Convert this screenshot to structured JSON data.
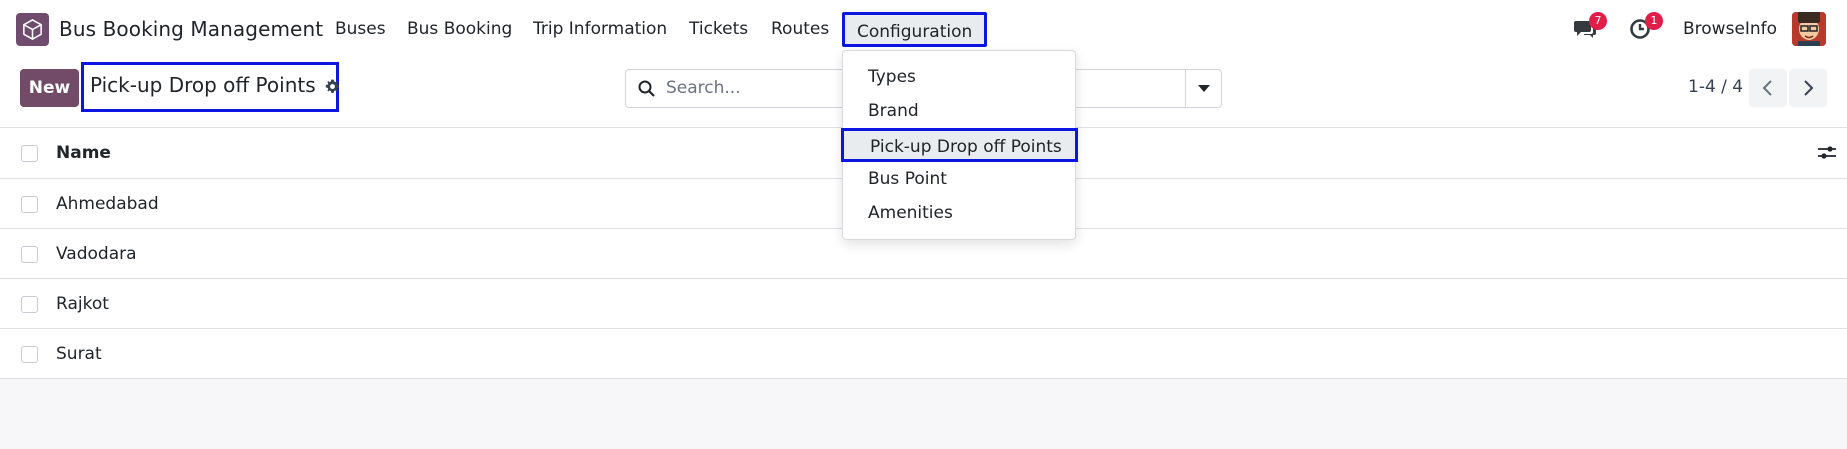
{
  "navbar": {
    "app_title": "Bus Booking Management",
    "menu": [
      {
        "label": "Buses"
      },
      {
        "label": "Bus Booking"
      },
      {
        "label": "Trip Information"
      },
      {
        "label": "Tickets"
      },
      {
        "label": "Routes"
      },
      {
        "label": "Configuration"
      }
    ],
    "messages_badge": "7",
    "activities_badge": "1",
    "company": "BrowseInfo"
  },
  "control_panel": {
    "new_label": "New",
    "breadcrumb": "Pick-up Drop off Points",
    "search_placeholder": "Search...",
    "pager": "1-4 / 4"
  },
  "list": {
    "column_name": "Name",
    "rows": [
      "Ahmedabad",
      "Vadodara",
      "Rajkot",
      "Surat"
    ]
  },
  "dropdown": {
    "items": [
      "Types",
      "Brand",
      "Pick-up Drop off Points",
      "Bus Point",
      "Amenities"
    ]
  },
  "colors": {
    "brand": "#714b67",
    "highlight_border": "#0b16e0",
    "badge": "#e11d48"
  }
}
